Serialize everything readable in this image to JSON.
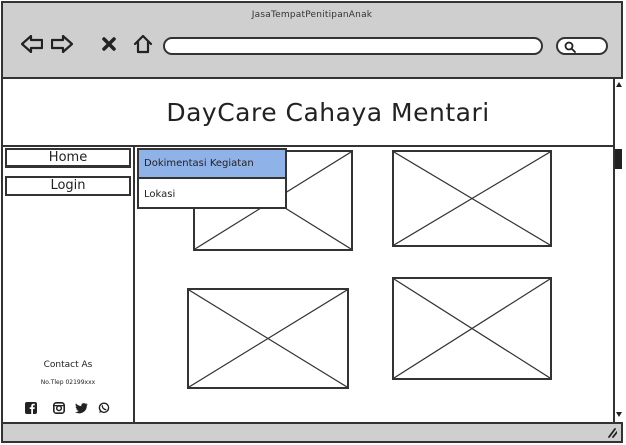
{
  "window": {
    "title": "JasaTempatPenitipanAnak",
    "address_value": ""
  },
  "header": {
    "title": "DayCare Cahaya Mentari"
  },
  "sidebar": {
    "items": [
      {
        "label": "Home"
      },
      {
        "label": "Login"
      }
    ],
    "contact": {
      "title": "Contact As",
      "phone": "No.Tlep 02199xxx"
    },
    "social_icons": [
      "facebook-icon",
      "instagram-icon",
      "twitter-icon",
      "whatsapp-icon"
    ]
  },
  "dropdown": {
    "items": [
      {
        "label": "Dokimentasi Kegiatan",
        "highlighted": true
      },
      {
        "label": "Lokasi",
        "highlighted": false
      }
    ]
  },
  "content": {
    "image_placeholders": 4
  },
  "colors": {
    "chrome": "#cfcfcf",
    "highlight": "#8fb3e8",
    "stroke": "#333333"
  }
}
